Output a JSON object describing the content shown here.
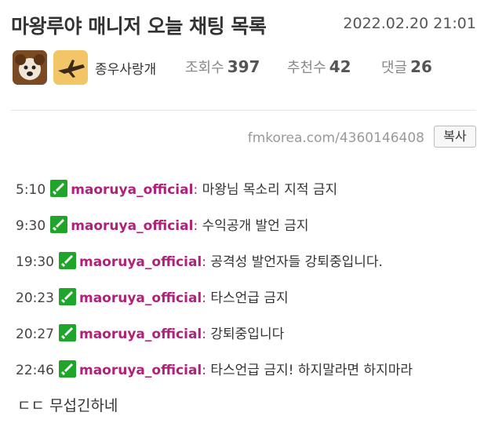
{
  "post": {
    "title": "마왕루야 매니저 오늘 채팅 목록",
    "date": "2022.02.20 21:01"
  },
  "meta": {
    "author": "종우사랑개",
    "views_label": "조회수",
    "views": "397",
    "recs_label": "추천수",
    "recs": "42",
    "comments_label": "댓글",
    "comments": "26"
  },
  "link": {
    "url": "fmkorea.com/4360146408",
    "copy_label": "복사"
  },
  "chat": {
    "rows": [
      {
        "time": "5:10",
        "user": "maoruya_official",
        "colon": ":",
        "message": " 마왕님 목소리 지적 금지"
      },
      {
        "time": "9:30",
        "user": "maoruya_official",
        "colon": ":",
        "message": " 수익공개 발언 금지"
      },
      {
        "time": "19:30",
        "user": "maoruya_official",
        "colon": ":",
        "message": " 공격성 발언자들 강퇴중입니다."
      },
      {
        "time": "20:23",
        "user": "maoruya_official",
        "colon": ":",
        "message": " 타스언급 금지"
      },
      {
        "time": "20:27",
        "user": "maoruya_official",
        "colon": ":",
        "message": " 강퇴중입니다"
      },
      {
        "time": "22:46",
        "user": "maoruya_official",
        "colon": ":",
        "message": " 타스언급 금지! 하지말라면 하지마라"
      }
    ]
  },
  "comment": "ㄷㄷ 무섭긴하네",
  "colors": {
    "username": "#b0217a",
    "mod_badge": "#1fa62a"
  }
}
